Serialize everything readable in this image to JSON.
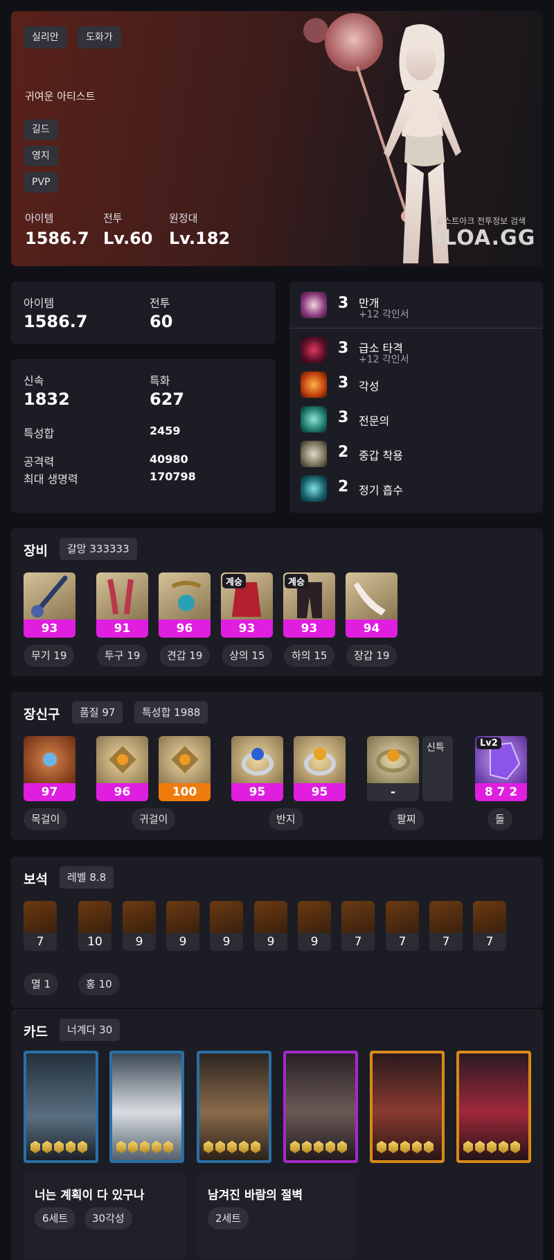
{
  "profile": {
    "server": "실리안",
    "class": "도화가",
    "title": "귀여운 아티스트",
    "guild_label": "길드",
    "territory_label": "영지",
    "pvp_label": "PVP",
    "item_label": "아이템",
    "item_value": "1586.7",
    "combat_label": "전투",
    "combat_value": "Lv.60",
    "expedition_label": "원정대",
    "expedition_value": "Lv.182",
    "watermark_sub": "로스트아크 전투정보 검색",
    "watermark": "ILOA.GG"
  },
  "summary": {
    "item_label": "아이템",
    "item_value": "1586.7",
    "combat_label": "전투",
    "combat_value": "60"
  },
  "stats": {
    "swift_label": "신속",
    "swift_value": "1832",
    "crit_label": "특화",
    "crit_value": "627",
    "total_label": "특성합",
    "total_value": "2459",
    "attack_label": "공격력",
    "attack_value": "40980",
    "hp_label": "최대 생명력",
    "hp_value": "170798"
  },
  "engravings": [
    {
      "level": "3",
      "name": "만개",
      "sub": "+12 각인서"
    },
    {
      "level": "3",
      "name": "급소 타격",
      "sub": "+12 각인서"
    },
    {
      "level": "3",
      "name": "각성",
      "sub": ""
    },
    {
      "level": "3",
      "name": "전문의",
      "sub": ""
    },
    {
      "level": "2",
      "name": "중갑 착용",
      "sub": ""
    },
    {
      "level": "2",
      "name": "정기 흡수",
      "sub": ""
    }
  ],
  "equipment": {
    "title": "장비",
    "tag": "갈망 333333",
    "items": [
      {
        "quality": "93",
        "slot": "무기 19",
        "badge": ""
      },
      {
        "quality": "91",
        "slot": "투구 19",
        "badge": ""
      },
      {
        "quality": "96",
        "slot": "견갑 19",
        "badge": ""
      },
      {
        "quality": "93",
        "slot": "상의 15",
        "badge": "계승"
      },
      {
        "quality": "93",
        "slot": "하의 15",
        "badge": "계승"
      },
      {
        "quality": "94",
        "slot": "장갑 19",
        "badge": ""
      }
    ]
  },
  "accessories": {
    "title": "장신구",
    "tag1": "품질 97",
    "tag2": "특성합 1988",
    "items": [
      {
        "quality": "97"
      },
      {
        "quality": "96"
      },
      {
        "quality": "100"
      },
      {
        "quality": "95"
      },
      {
        "quality": "95"
      },
      {
        "quality": "-"
      },
      {
        "quality": "8 7 2"
      }
    ],
    "special_label": "신특",
    "stone_badge": "Lv2",
    "slots": [
      "목걸이",
      "귀걸이",
      "반지",
      "팔찌",
      "돌"
    ]
  },
  "gems": {
    "title": "보석",
    "tag": "레벨 8.8",
    "levels": [
      "7",
      "10",
      "9",
      "9",
      "9",
      "9",
      "9",
      "7",
      "7",
      "7",
      "7"
    ],
    "summary1": "멸 1",
    "summary2": "홍 10"
  },
  "cards": {
    "title": "카드",
    "tag": "너계다 30",
    "sets": [
      {
        "name": "너는 계획이 다 있구나",
        "tags": [
          "6세트",
          "30각성"
        ]
      },
      {
        "name": "남겨진 바람의 절벽",
        "tags": [
          "2세트"
        ]
      }
    ]
  },
  "colors": {
    "quality_purple": "#e01ee0",
    "quality_orange": "#ef7a0d",
    "panel": "#1c1d24"
  }
}
